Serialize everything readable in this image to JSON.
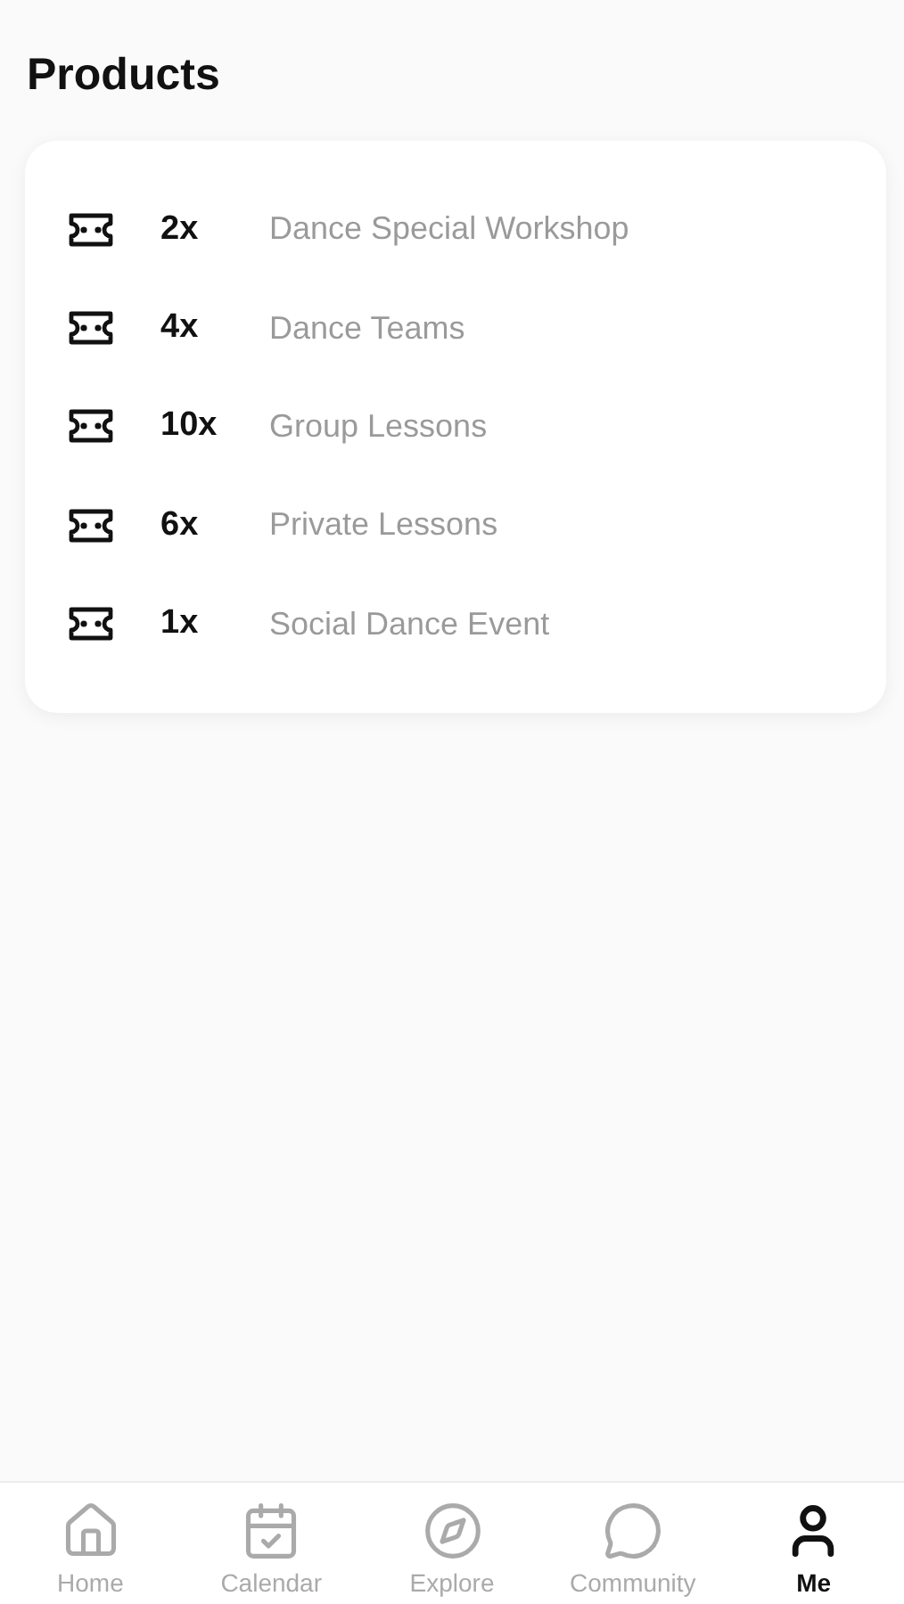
{
  "title": "Products",
  "products": [
    {
      "count": "2x",
      "name": "Dance Special Workshop"
    },
    {
      "count": "4x",
      "name": "Dance Teams"
    },
    {
      "count": "10x",
      "name": "Group Lessons"
    },
    {
      "count": "6x",
      "name": "Private Lessons"
    },
    {
      "count": "1x",
      "name": "Social Dance Event"
    }
  ],
  "tabs": [
    {
      "kind": "home",
      "label": "Home",
      "selected": false
    },
    {
      "kind": "calendar",
      "label": "Calendar",
      "selected": false
    },
    {
      "kind": "explore",
      "label": "Explore",
      "selected": false
    },
    {
      "kind": "community",
      "label": "Community",
      "selected": false
    },
    {
      "kind": "me",
      "label": "Me",
      "selected": true
    }
  ]
}
